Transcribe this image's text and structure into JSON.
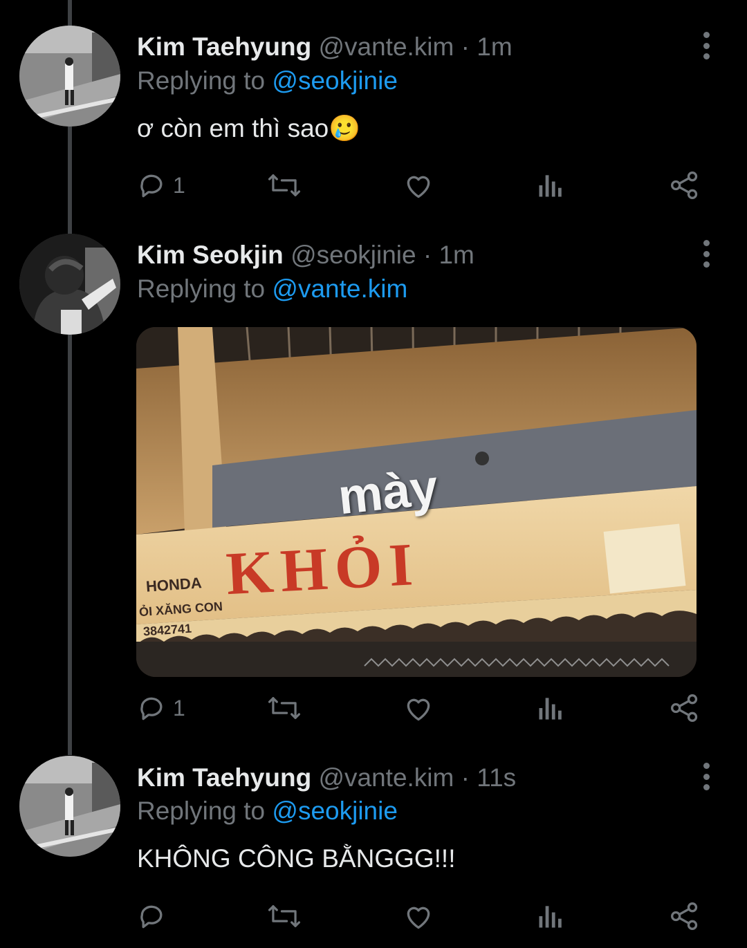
{
  "tweets": [
    {
      "name": "Kim Taehyung",
      "handle": "@vante.kim",
      "separator": "·",
      "time": "1m",
      "replying_prefix": "Replying to",
      "replying_to": "@seokjinie",
      "text": "ơ còn em thì sao",
      "emoji": "🥲",
      "reply_count": "1"
    },
    {
      "name": "Kim Seokjin",
      "handle": "@seokjinie",
      "separator": "·",
      "time": "1m",
      "replying_prefix": "Replying to",
      "replying_to": "@vante.kim",
      "media": {
        "overlay_text": "mày",
        "sign_main": "KHỎI",
        "sign_left_1": "HONDA",
        "sign_left_2": "ỎI XĂNG CON",
        "sign_left_3": "3842741"
      },
      "reply_count": "1"
    },
    {
      "name": "Kim Taehyung",
      "handle": "@vante.kim",
      "separator": "·",
      "time": "11s",
      "replying_prefix": "Replying to",
      "replying_to": "@seokjinie",
      "text": "KHÔNG CÔNG BẰNGGG!!!",
      "reply_count": ""
    }
  ],
  "icons": [
    "reply-icon",
    "retweet-icon",
    "like-icon",
    "views-icon",
    "share-icon",
    "more-icon"
  ],
  "colors": {
    "background": "#000000",
    "mention": "#1d9bf0",
    "muted": "#71767b",
    "thread_line": "#3e4144"
  }
}
